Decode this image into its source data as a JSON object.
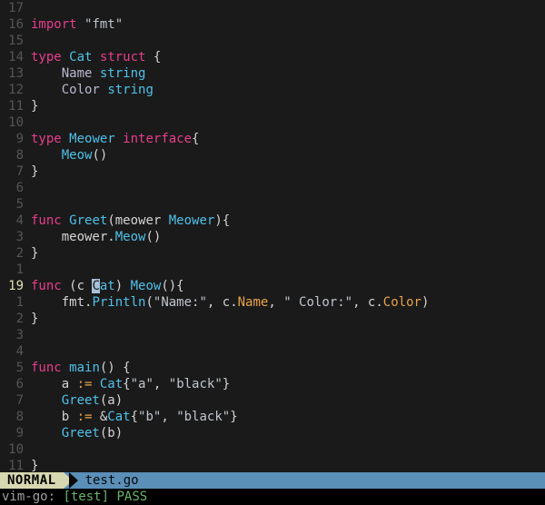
{
  "lines": [
    {
      "n": "17",
      "cursor": false,
      "tokens": []
    },
    {
      "n": "16",
      "cursor": false,
      "tokens": [
        [
          "kw-import",
          "import"
        ],
        [
          "op",
          " "
        ],
        [
          "str",
          "\"fmt\""
        ]
      ]
    },
    {
      "n": "15",
      "cursor": false,
      "tokens": []
    },
    {
      "n": "14",
      "cursor": false,
      "tokens": [
        [
          "kw-type",
          "type"
        ],
        [
          "op",
          " "
        ],
        [
          "typ",
          "Cat"
        ],
        [
          "op",
          " "
        ],
        [
          "kw-struct",
          "struct"
        ],
        [
          "op",
          " {"
        ]
      ]
    },
    {
      "n": "13",
      "cursor": false,
      "tokens": [
        [
          "op",
          "    "
        ],
        [
          "ident",
          "Name"
        ],
        [
          "op",
          " "
        ],
        [
          "typ",
          "string"
        ]
      ]
    },
    {
      "n": "12",
      "cursor": false,
      "tokens": [
        [
          "op",
          "    "
        ],
        [
          "ident",
          "Color"
        ],
        [
          "op",
          " "
        ],
        [
          "typ",
          "string"
        ]
      ]
    },
    {
      "n": "11",
      "cursor": false,
      "tokens": [
        [
          "op",
          "}"
        ]
      ]
    },
    {
      "n": "10",
      "cursor": false,
      "tokens": []
    },
    {
      "n": "9",
      "cursor": false,
      "tokens": [
        [
          "kw-type",
          "type"
        ],
        [
          "op",
          " "
        ],
        [
          "typ",
          "Meower"
        ],
        [
          "op",
          " "
        ],
        [
          "kw-interface",
          "interface"
        ],
        [
          "op",
          "{"
        ]
      ]
    },
    {
      "n": "8",
      "cursor": false,
      "tokens": [
        [
          "op",
          "    "
        ],
        [
          "typ",
          "Meow"
        ],
        [
          "op",
          "()"
        ]
      ]
    },
    {
      "n": "7",
      "cursor": false,
      "tokens": [
        [
          "op",
          "}"
        ]
      ]
    },
    {
      "n": "6",
      "cursor": false,
      "tokens": []
    },
    {
      "n": "5",
      "cursor": false,
      "tokens": []
    },
    {
      "n": "4",
      "cursor": false,
      "tokens": [
        [
          "kw-func",
          "func"
        ],
        [
          "op",
          " "
        ],
        [
          "typ",
          "Greet"
        ],
        [
          "op",
          "(meower "
        ],
        [
          "typ",
          "Meower"
        ],
        [
          "op",
          "){"
        ]
      ]
    },
    {
      "n": "3",
      "cursor": false,
      "tokens": [
        [
          "op",
          "    meower."
        ],
        [
          "typ",
          "Meow"
        ],
        [
          "op",
          "()"
        ]
      ]
    },
    {
      "n": "2",
      "cursor": false,
      "tokens": [
        [
          "op",
          "}"
        ]
      ]
    },
    {
      "n": "1",
      "cursor": false,
      "tokens": []
    },
    {
      "n": "19",
      "cursor": true,
      "tokens": [
        [
          "kw-func",
          "func"
        ],
        [
          "op",
          " (c "
        ],
        [
          "cursor",
          "C"
        ],
        [
          "typ",
          "at"
        ],
        [
          "op",
          ") "
        ],
        [
          "typ",
          "Meow"
        ],
        [
          "op",
          "(){"
        ]
      ]
    },
    {
      "n": "1",
      "cursor": false,
      "tokens": [
        [
          "op",
          "    fmt."
        ],
        [
          "typ",
          "Println"
        ],
        [
          "op",
          "("
        ],
        [
          "str",
          "\"Name:\""
        ],
        [
          "op",
          ", c."
        ],
        [
          "field",
          "Name"
        ],
        [
          "op",
          ", "
        ],
        [
          "str",
          "\" Color:\""
        ],
        [
          "op",
          ", c."
        ],
        [
          "field",
          "Color"
        ],
        [
          "op",
          ")"
        ]
      ]
    },
    {
      "n": "2",
      "cursor": false,
      "tokens": [
        [
          "op",
          "}"
        ]
      ]
    },
    {
      "n": "3",
      "cursor": false,
      "tokens": []
    },
    {
      "n": "4",
      "cursor": false,
      "tokens": []
    },
    {
      "n": "5",
      "cursor": false,
      "tokens": [
        [
          "kw-func",
          "func"
        ],
        [
          "op",
          " "
        ],
        [
          "typ",
          "main"
        ],
        [
          "op",
          "() {"
        ]
      ]
    },
    {
      "n": "6",
      "cursor": false,
      "tokens": [
        [
          "op",
          "    a "
        ],
        [
          "assign",
          ":="
        ],
        [
          "op",
          " "
        ],
        [
          "typ",
          "Cat"
        ],
        [
          "op",
          "{"
        ],
        [
          "str",
          "\"a\""
        ],
        [
          "op",
          ", "
        ],
        [
          "str",
          "\"black\""
        ],
        [
          "op",
          "}"
        ]
      ]
    },
    {
      "n": "7",
      "cursor": false,
      "tokens": [
        [
          "op",
          "    "
        ],
        [
          "typ",
          "Greet"
        ],
        [
          "op",
          "(a)"
        ]
      ]
    },
    {
      "n": "8",
      "cursor": false,
      "tokens": [
        [
          "op",
          "    b "
        ],
        [
          "assign",
          ":="
        ],
        [
          "op",
          " &"
        ],
        [
          "typ",
          "Cat"
        ],
        [
          "op",
          "{"
        ],
        [
          "str",
          "\"b\""
        ],
        [
          "op",
          ", "
        ],
        [
          "str",
          "\"black\""
        ],
        [
          "op",
          "}"
        ]
      ]
    },
    {
      "n": "9",
      "cursor": false,
      "tokens": [
        [
          "op",
          "    "
        ],
        [
          "typ",
          "Greet"
        ],
        [
          "op",
          "(b)"
        ]
      ]
    },
    {
      "n": "10",
      "cursor": false,
      "tokens": []
    },
    {
      "n": "11",
      "cursor": false,
      "tokens": [
        [
          "op",
          "}"
        ]
      ]
    }
  ],
  "tilde": "~",
  "status": {
    "mode": "NORMAL",
    "file": "test.go"
  },
  "message": {
    "prefix": "vim-go:",
    "tag": "[test]",
    "result": "PASS"
  }
}
